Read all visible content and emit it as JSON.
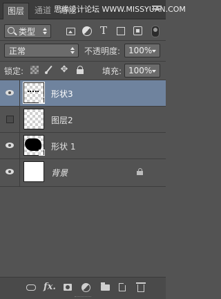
{
  "tabs": [
    {
      "label": "图层",
      "active": true
    },
    {
      "label": "通道",
      "active": false
    },
    {
      "label": "路径",
      "active": false
    }
  ],
  "watermark": "思缘设计论坛 WWW.MISSYUAN.COM",
  "filter": {
    "kind_label": "类型"
  },
  "blend": {
    "mode": "正常",
    "opacity_label": "不透明度:",
    "opacity_value": "100%"
  },
  "lock": {
    "label": "锁定:",
    "fill_label": "填充:",
    "fill_value": "100%"
  },
  "layers": [
    {
      "name": "形状3",
      "visible": true,
      "selected": true
    },
    {
      "name": "图层2",
      "visible": false,
      "selected": false
    },
    {
      "name": "形状 1",
      "visible": true,
      "selected": false
    },
    {
      "name": "背景",
      "visible": true,
      "selected": false,
      "locked": true
    }
  ],
  "colors": {
    "panel_bg": "#535353",
    "selected_row": "#6f839e",
    "tabbar_bg": "#3c3c3c"
  }
}
